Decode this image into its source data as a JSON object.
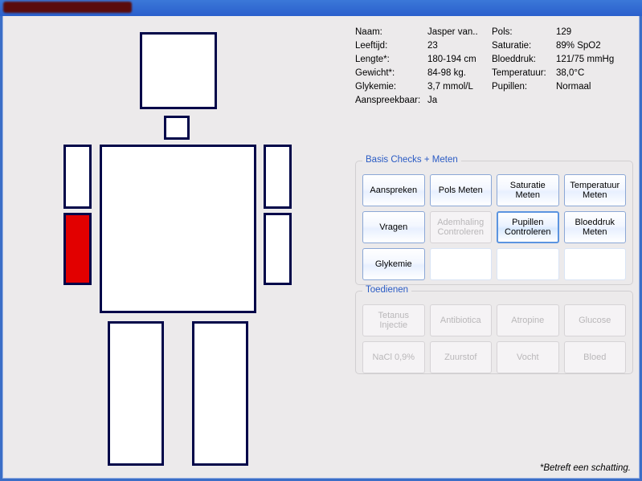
{
  "info": {
    "rows": [
      {
        "k": "Naam:",
        "v": "Jasper van..",
        "k2": "Pols:",
        "v2": "129"
      },
      {
        "k": "Leeftijd:",
        "v": "23",
        "k2": "Saturatie:",
        "v2": "89% SpO2"
      },
      {
        "k": "Lengte*:",
        "v": "180-194 cm",
        "k2": "Bloeddruk:",
        "v2": "121/75 mmHg"
      },
      {
        "k": "Gewicht*:",
        "v": "84-98 kg.",
        "k2": "Temperatuur:",
        "v2": "38,0°C"
      },
      {
        "k": "Glykemie:",
        "v": "3,7 mmol/L",
        "k2": "Pupillen:",
        "v2": "Normaal"
      },
      {
        "k": "Aanspreekbaar:",
        "v": "Ja",
        "k2": "",
        "v2": ""
      }
    ]
  },
  "groups": {
    "checks": {
      "title": "Basis Checks + Meten",
      "buttons": [
        {
          "label": "Aanspreken",
          "state": "normal"
        },
        {
          "label": "Pols Meten",
          "state": "normal"
        },
        {
          "label": "Saturatie Meten",
          "state": "normal"
        },
        {
          "label": "Temperatuur Meten",
          "state": "normal"
        },
        {
          "label": "Vragen",
          "state": "normal"
        },
        {
          "label": "Ademhaling Controleren",
          "state": "disabled"
        },
        {
          "label": "Pupillen Controleren",
          "state": "focused"
        },
        {
          "label": "Bloeddruk Meten",
          "state": "normal"
        },
        {
          "label": "Glykemie",
          "state": "normal"
        },
        {
          "label": "",
          "state": "empty"
        },
        {
          "label": "",
          "state": "empty"
        },
        {
          "label": "",
          "state": "empty"
        }
      ]
    },
    "administer": {
      "title": "Toedienen",
      "buttons": [
        {
          "label": "Tetanus Injectie"
        },
        {
          "label": "Antibiotica"
        },
        {
          "label": "Atropine"
        },
        {
          "label": "Glucose"
        },
        {
          "label": "NaCl 0,9%"
        },
        {
          "label": "Zuurstof"
        },
        {
          "label": "Vocht"
        },
        {
          "label": "Bloed"
        }
      ]
    }
  },
  "body_parts": {
    "highlighted": "lower-left-arm"
  },
  "footer_note": "*Betreft een schatting."
}
